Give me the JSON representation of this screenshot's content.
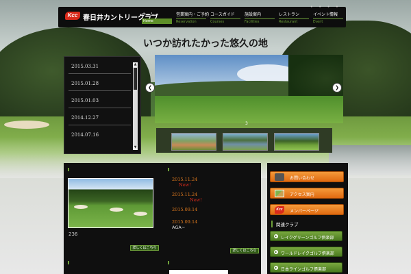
{
  "header": {
    "logo_badge": "Kcc",
    "logo_text": "春日井カントリークラブ",
    "nav": [
      {
        "jp": "ホーム",
        "en": "Home"
      },
      {
        "jp": "営業案内・ご予約",
        "en": "Reservation"
      },
      {
        "jp": "コースガイド",
        "en": "Courses"
      },
      {
        "jp": "施設案内",
        "en": "Facilities"
      },
      {
        "jp": "レストラン",
        "en": "Restaurant"
      },
      {
        "jp": "イベント情報",
        "en": "Event"
      }
    ],
    "dots": "• • • •"
  },
  "tagline": "いつか訪れたかった悠久の地",
  "news_sidebar": {
    "dates": [
      "2015.03.31",
      "2015.01.28",
      "2015.01.03",
      "2014.12.27",
      "2014.07.16"
    ]
  },
  "slideshow": {
    "prev_icon": "❮",
    "next_icon": "❯",
    "slide_number": "3"
  },
  "main": {
    "photo_caption": "236",
    "more_label": "詳しくはこちら",
    "news": [
      {
        "date": "2015.11.24",
        "new": "New!",
        "text": ""
      },
      {
        "date": "2015.11.24",
        "new": "New!",
        "text": ""
      },
      {
        "date": "2015.09.14",
        "new": "",
        "text": ""
      },
      {
        "date": "2015.09.14",
        "new": "",
        "text": "AGA~"
      }
    ]
  },
  "sidebar": {
    "buttons": [
      {
        "label": "お問い合わせ",
        "icon": "phone-icon"
      },
      {
        "label": "アクセス案内",
        "icon": "map-icon"
      },
      {
        "label": "メンバーページ",
        "icon": "kcc-logo-icon",
        "icon_text": "Kcc"
      }
    ],
    "related_title": "関連クラブ",
    "related": [
      {
        "label": "レイクグリーンゴルフ倶楽部"
      },
      {
        "label": "ワールドレイクゴルフ倶楽部"
      },
      {
        "label": "日本ラインゴルフ倶楽部"
      }
    ]
  },
  "colors": {
    "accent_green": "#6fa23a",
    "accent_orange": "#e06a10",
    "brand_red": "#d92b1b"
  }
}
